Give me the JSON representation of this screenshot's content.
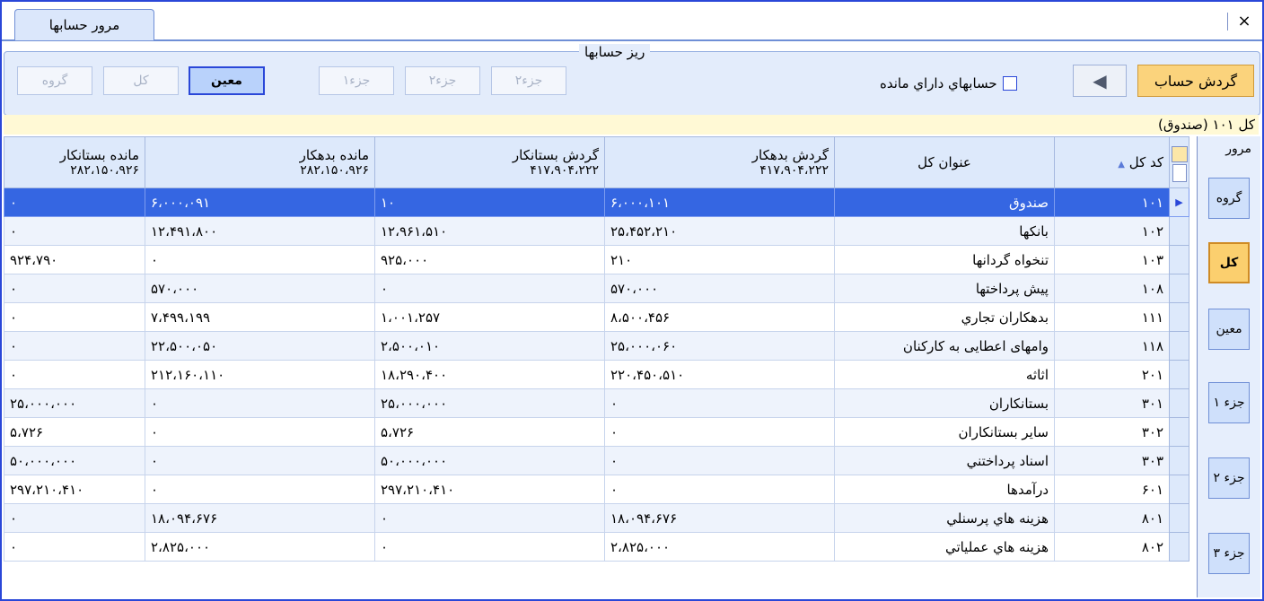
{
  "tab": {
    "label": "مرور حسابها"
  },
  "close_label": "×",
  "toolbar": {
    "title": "ريز حسابها",
    "gardesh_btn": "گردش حساب",
    "arrow": "◀",
    "checkbox_label": "حسابهاي داراي مانده",
    "levels": [
      {
        "label": "گروه",
        "active": false
      },
      {
        "label": "كل",
        "active": false
      },
      {
        "label": "معين",
        "active": true
      },
      {
        "label": "جزء۱",
        "active": false
      },
      {
        "label": "جزء۲",
        "active": false
      },
      {
        "label": "جزء۲",
        "active": false
      }
    ]
  },
  "status": "كل ۱۰۱ (صندوق)",
  "grid": {
    "headers": {
      "code": "كد كل",
      "title": "عنوان كل",
      "debit_turnover": "گردش بدهكار",
      "debit_turnover_total": "۴۱۷،۹۰۴،۲۲۲",
      "credit_turnover": "گردش بستانكار",
      "credit_turnover_total": "۴۱۷،۹۰۴،۲۲۲",
      "debit_balance": "مانده بدهكار",
      "debit_balance_total": "۲۸۲،۱۵۰،۹۲۶",
      "credit_balance": "مانده بستانكار",
      "credit_balance_total": "۲۸۲،۱۵۰،۹۲۶"
    },
    "rows": [
      {
        "code": "۱۰۱",
        "title": "صندوق",
        "dt": "۶،۰۰۰،۱۰۱",
        "ct": "۱۰",
        "db": "۶،۰۰۰،۰۹۱",
        "cb": "۰"
      },
      {
        "code": "۱۰۲",
        "title": "بانكها",
        "dt": "۲۵،۴۵۲،۲۱۰",
        "ct": "۱۲،۹۶۱،۵۱۰",
        "db": "۱۲،۴۹۱،۸۰۰",
        "cb": "۰"
      },
      {
        "code": "۱۰۳",
        "title": "تنخواه گردانها",
        "dt": "۲۱۰",
        "ct": "۹۲۵،۰۰۰",
        "db": "۰",
        "cb": "۹۲۴،۷۹۰"
      },
      {
        "code": "۱۰۸",
        "title": "پيش پرداختها",
        "dt": "۵۷۰،۰۰۰",
        "ct": "۰",
        "db": "۵۷۰،۰۰۰",
        "cb": "۰"
      },
      {
        "code": "۱۱۱",
        "title": "بدهكاران تجاري",
        "dt": "۸،۵۰۰،۴۵۶",
        "ct": "۱،۰۰۱،۲۵۷",
        "db": "۷،۴۹۹،۱۹۹",
        "cb": "۰"
      },
      {
        "code": "۱۱۸",
        "title": "وامهای اعطایی به کارکنان",
        "dt": "۲۵،۰۰۰،۰۶۰",
        "ct": "۲،۵۰۰،۰۱۰",
        "db": "۲۲،۵۰۰،۰۵۰",
        "cb": "۰"
      },
      {
        "code": "۲۰۱",
        "title": "اثاثه",
        "dt": "۲۲۰،۴۵۰،۵۱۰",
        "ct": "۱۸،۲۹۰،۴۰۰",
        "db": "۲۱۲،۱۶۰،۱۱۰",
        "cb": "۰"
      },
      {
        "code": "۳۰۱",
        "title": "بستانكاران",
        "dt": "۰",
        "ct": "۲۵،۰۰۰،۰۰۰",
        "db": "۰",
        "cb": "۲۵،۰۰۰،۰۰۰"
      },
      {
        "code": "۳۰۲",
        "title": "ساير بستانكاران",
        "dt": "۰",
        "ct": "۵،۷۲۶",
        "db": "۰",
        "cb": "۵،۷۲۶"
      },
      {
        "code": "۳۰۳",
        "title": "اسناد پرداختني",
        "dt": "۰",
        "ct": "۵۰،۰۰۰،۰۰۰",
        "db": "۰",
        "cb": "۵۰،۰۰۰،۰۰۰"
      },
      {
        "code": "۶۰۱",
        "title": "درآمدها",
        "dt": "۰",
        "ct": "۲۹۷،۲۱۰،۴۱۰",
        "db": "۰",
        "cb": "۲۹۷،۲۱۰،۴۱۰"
      },
      {
        "code": "۸۰۱",
        "title": "هزينه هاي پرسنلي",
        "dt": "۱۸،۰۹۴،۶۷۶",
        "ct": "۰",
        "db": "۱۸،۰۹۴،۶۷۶",
        "cb": "۰"
      },
      {
        "code": "۸۰۲",
        "title": "هزينه هاي عملياتي",
        "dt": "۲،۸۲۵،۰۰۰",
        "ct": "۰",
        "db": "۲،۸۲۵،۰۰۰",
        "cb": "۰"
      }
    ]
  },
  "rightnav": {
    "title": "مرور",
    "items": [
      {
        "label": "گروه",
        "active": false
      },
      {
        "label": "كل",
        "active": true
      },
      {
        "label": "معين",
        "active": false
      },
      {
        "label": "جزء ۱",
        "active": false
      },
      {
        "label": "جزء ۲",
        "active": false
      },
      {
        "label": "جزء ۳",
        "active": false
      }
    ]
  },
  "colors": {
    "accent": "#2a47d8",
    "selected": "#3566e2",
    "gold": "#fbd37c"
  }
}
